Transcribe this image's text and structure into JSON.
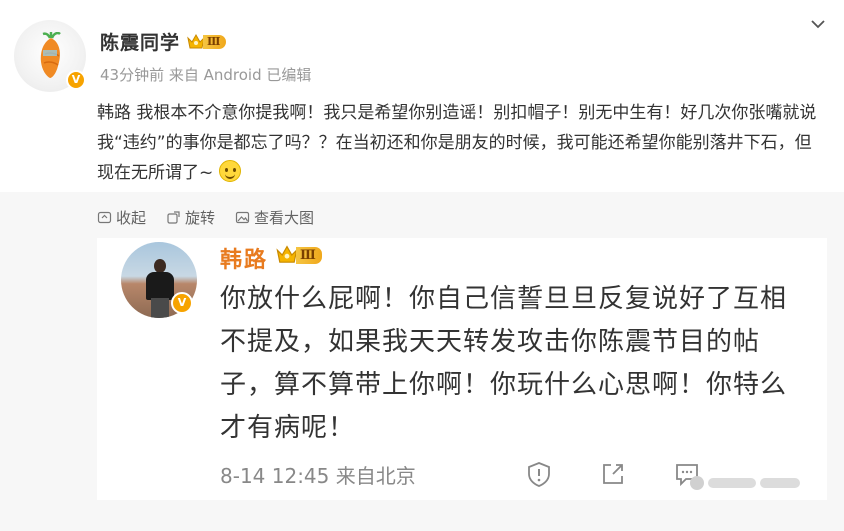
{
  "post": {
    "author": "陈震同学",
    "rank_level": "Ⅲ",
    "meta": "43分钟前 来自 Android 已编辑",
    "text": "韩路 我根本不介意你提我啊！我只是希望你别造谣！别扣帽子！别无中生有！好几次你张嘴就说我“违约”的事你是都忘了吗？？在当初还和你是朋友的时候，我可能还希望你能别落井下石，但现在无所谓了~",
    "emoji_icon": "smile-emoji",
    "verified_badge": "V"
  },
  "actions": {
    "collapse": "收起",
    "rotate": "旋转",
    "view_large": "查看大图"
  },
  "embedded": {
    "author": "韩路",
    "rank_level": "Ⅲ",
    "verified_badge": "V",
    "text": "你放什么屁啊！你自己信誓旦旦反复说好了互相不提及，如果我天天转发攻击你陈震节目的帖子，算不算带上你啊！你玩什么心思啊！你特么才有病呢！",
    "footer": "8-14 12:45 来自北京"
  },
  "colors": {
    "accent_name": "#e87b1f",
    "badge": "#f7a300",
    "meta_gray": "#999999",
    "panel_bg": "#f7f7f7"
  }
}
